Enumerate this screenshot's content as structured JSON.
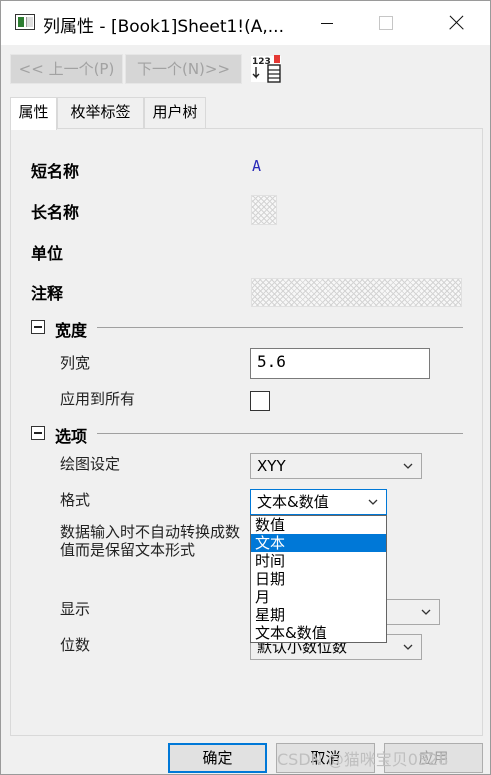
{
  "window": {
    "title": "列属性 - [Book1]Sheet1!(A,..."
  },
  "nav": {
    "prev_label": "<< 上一个(P)",
    "next_label": "下一个(N)>>",
    "tool_icon": "spreadsheet-column-icon"
  },
  "tabs": [
    {
      "label": "属性"
    },
    {
      "label": "枚举标签"
    },
    {
      "label": "用户树"
    }
  ],
  "props": {
    "short_name_label": "短名称",
    "short_name_value": "A",
    "long_name_label": "长名称",
    "unit_label": "单位",
    "comment_label": "注释"
  },
  "width_section": {
    "title": "宽度",
    "col_width_label": "列宽",
    "col_width_value": "5.6",
    "apply_all_label": "应用到所有"
  },
  "options_section": {
    "title": "选项",
    "plot_label": "绘图设定",
    "plot_value": "XYY",
    "format_label": "格式",
    "format_value": "文本&数值",
    "no_convert_label": "数据输入时不自动转换成数值而是保留文本形式",
    "display_label": "显示",
    "digits_label": "位数",
    "digits_value": "默认小数位数"
  },
  "format_options": [
    "数值",
    "文本",
    "时间",
    "日期",
    "月",
    "星期",
    "文本&数值"
  ],
  "format_highlighted": "文本",
  "buttons": {
    "ok": "确定",
    "cancel": "取消",
    "apply": "应用"
  },
  "watermark": "CSDN @猫咪宝贝0328",
  "colors": {
    "accent": "#0078d7",
    "short_name_text": "#2a2ab8"
  }
}
